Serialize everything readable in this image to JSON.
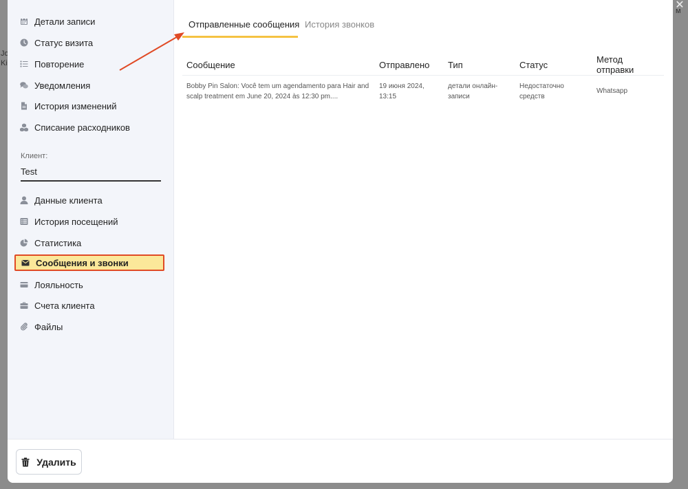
{
  "background": {
    "fragments": [
      "Jo",
      "Ki",
      "м"
    ],
    "close_icon": "close-icon"
  },
  "sidebar": {
    "top_items": [
      {
        "label": "Детали записи",
        "icon": "calendar-icon"
      },
      {
        "label": "Статус визита",
        "icon": "clock-icon"
      },
      {
        "label": "Повторение",
        "icon": "list-icon"
      },
      {
        "label": "Уведомления",
        "icon": "chat-icon"
      },
      {
        "label": "История изменений",
        "icon": "document-icon"
      },
      {
        "label": "Списание расходников",
        "icon": "cubes-icon"
      }
    ],
    "client_label": "Клиент:",
    "client_value": "Test",
    "bottom_items": [
      {
        "label": "Данные клиента",
        "icon": "user-icon"
      },
      {
        "label": "История посещений",
        "icon": "history-list-icon"
      },
      {
        "label": "Статистика",
        "icon": "pie-chart-icon"
      },
      {
        "label": "Сообщения и звонки",
        "icon": "envelope-icon",
        "active": true
      },
      {
        "label": "Лояльность",
        "icon": "card-icon"
      },
      {
        "label": "Счета клиента",
        "icon": "briefcase-icon"
      },
      {
        "label": "Файлы",
        "icon": "paperclip-icon"
      }
    ]
  },
  "tabs": [
    {
      "label": "Отправленные сообщения",
      "active": true
    },
    {
      "label": "История звонков",
      "active": false
    }
  ],
  "table": {
    "headers": [
      "Сообщение",
      "Отправлено",
      "Тип",
      "Статус",
      "Метод отправки"
    ],
    "rows": [
      {
        "message": "Bobby Pin Salon: Você tem um agendamento para Hair and scalp treatment em June 20, 2024 às 12:30 pm....",
        "sent": "19 июня 2024, 13:15",
        "type": "детали онлайн-записи",
        "status": "Недостаточно средств",
        "method": "Whatsapp"
      }
    ]
  },
  "footer": {
    "delete_label": "Удалить",
    "delete_icon": "trash-icon"
  },
  "colors": {
    "active_bg": "#fbe89a",
    "active_border": "#e04a25",
    "tab_underline": "#f5c242",
    "arrow": "#e04a25"
  }
}
